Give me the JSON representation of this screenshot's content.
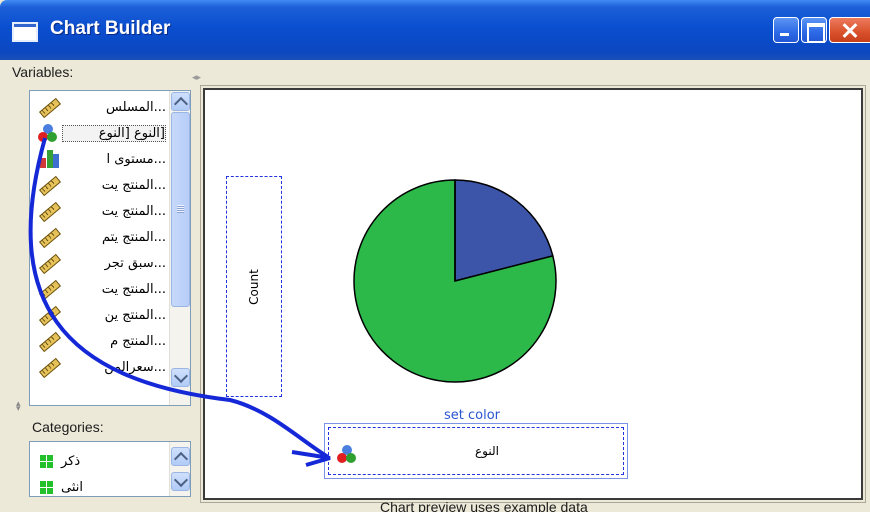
{
  "window": {
    "title": "Chart Builder",
    "icon": "window-app-icon"
  },
  "variables": {
    "label": "Variables:",
    "items": [
      {
        "label": "...المسلس",
        "icon": "scale-ruler-icon"
      },
      {
        "label": "[النوع [النوع",
        "icon": "nominal-balls-icon",
        "selected": true
      },
      {
        "label": "...مستوى ا",
        "icon": "ordinal-bars-icon"
      },
      {
        "label": "...المنتج يت",
        "icon": "scale-ruler-icon"
      },
      {
        "label": "...المنتج يت",
        "icon": "scale-ruler-icon"
      },
      {
        "label": "...المنتج يتم",
        "icon": "scale-ruler-icon"
      },
      {
        "label": "...سبق تجر",
        "icon": "scale-ruler-icon"
      },
      {
        "label": "...المنتج يت",
        "icon": "scale-ruler-icon"
      },
      {
        "label": "...المنتج ين",
        "icon": "scale-ruler-icon"
      },
      {
        "label": "...المنتج م",
        "icon": "scale-ruler-icon"
      },
      {
        "label": "...سعرالمن",
        "icon": "scale-ruler-icon"
      }
    ]
  },
  "categories": {
    "label": "Categories:",
    "items": [
      {
        "label": "ذكر"
      },
      {
        "label": "انثى"
      }
    ]
  },
  "canvas": {
    "y_axis_label": "Count",
    "set_color_label": "set color",
    "color_zone_variable": "النوع",
    "footnote": "Chart preview uses example data",
    "pie_colors": {
      "slice_1": "#3d55a8",
      "slice_2": "#2db84a"
    },
    "pie_fractions": [
      0.21,
      0.79
    ]
  }
}
